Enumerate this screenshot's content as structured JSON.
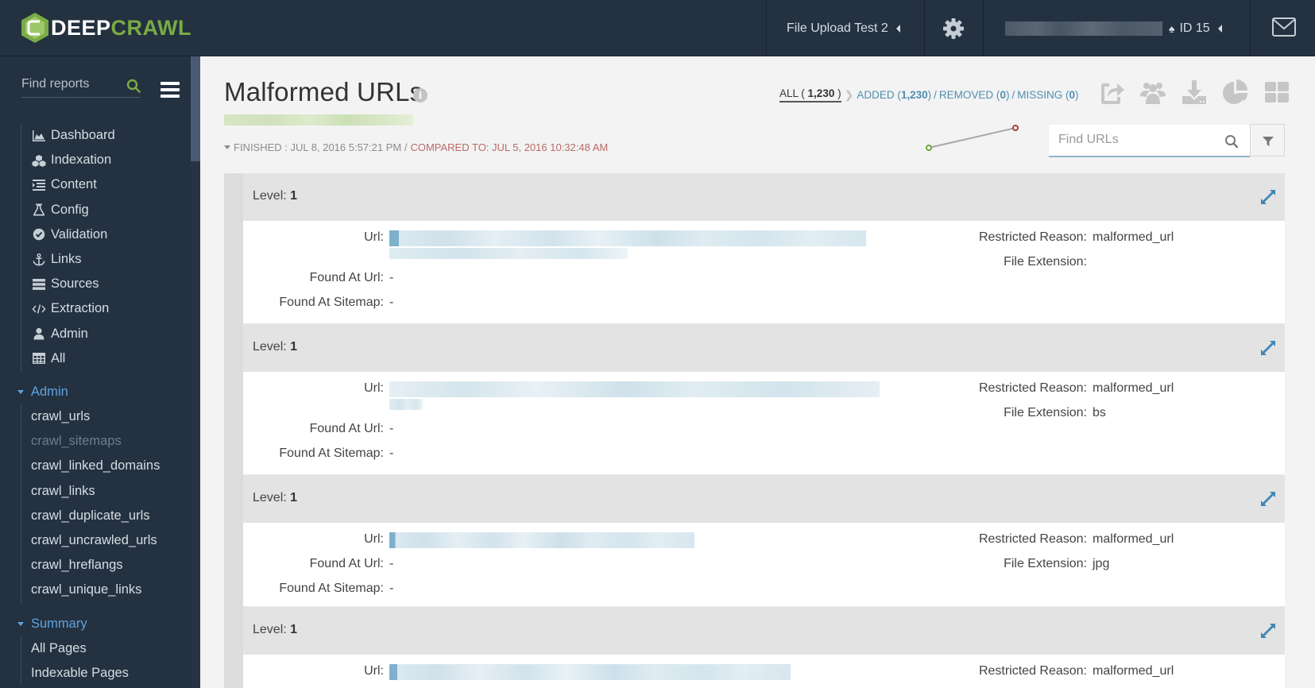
{
  "header": {
    "logo": {
      "part1": "DEEP",
      "part2": "CRAWL"
    },
    "project": "File Upload Test 2",
    "user_id": "ID 15",
    "icons": [
      "gear-icon",
      "spade-icon",
      "mail-icon"
    ]
  },
  "sidebar": {
    "search_placeholder": "Find reports",
    "nav": [
      {
        "label": "Dashboard",
        "icon": "chart-area-icon"
      },
      {
        "label": "Indexation",
        "icon": "cubes-icon"
      },
      {
        "label": "Content",
        "icon": "indent-list-icon"
      },
      {
        "label": "Config",
        "icon": "flask-icon"
      },
      {
        "label": "Validation",
        "icon": "check-circle-icon"
      },
      {
        "label": "Links",
        "icon": "anchor-icon"
      },
      {
        "label": "Sources",
        "icon": "server-icon"
      },
      {
        "label": "Extraction",
        "icon": "code-icon"
      },
      {
        "label": "Admin",
        "icon": "user-icon"
      },
      {
        "label": "All",
        "icon": "table-icon"
      }
    ],
    "sections": [
      {
        "title": "Admin",
        "items": [
          {
            "label": "crawl_urls",
            "disabled": false
          },
          {
            "label": "crawl_sitemaps",
            "disabled": true
          },
          {
            "label": "crawl_linked_domains",
            "disabled": false
          },
          {
            "label": "crawl_links",
            "disabled": false
          },
          {
            "label": "crawl_duplicate_urls",
            "disabled": false
          },
          {
            "label": "crawl_uncrawled_urls",
            "disabled": false
          },
          {
            "label": "crawl_hreflangs",
            "disabled": false
          },
          {
            "label": "crawl_unique_links",
            "disabled": false
          }
        ]
      },
      {
        "title": "Summary",
        "items": [
          {
            "label": "All Pages",
            "disabled": false
          },
          {
            "label": "Indexable Pages",
            "disabled": false
          }
        ]
      }
    ]
  },
  "report": {
    "title": "Malformed URLs",
    "finished": "FINISHED : JUL 8, 2016 5:57:21 PM /",
    "compared": "COMPARED TO: JUL 5, 2016 10:32:48 AM",
    "filters": {
      "all_label": "ALL (",
      "all_count": "1,230",
      "all_close": ")",
      "added_label": "ADDED (",
      "added_count": "1,230",
      "removed_label": "REMOVED (",
      "removed_count": "0",
      "missing_label": "MISSING (",
      "missing_count": "0",
      "close": ")",
      "slash": "/"
    },
    "actions": [
      "share-icon",
      "users-icon",
      "download-icon",
      "pie-chart-icon",
      "grid-icon"
    ],
    "sparkline": {
      "start_color": "#6aa43a",
      "end_color": "#a33a3a"
    },
    "find_urls_placeholder": "Find URLs"
  },
  "labels": {
    "level": "Level:",
    "url": "Url:",
    "found_at_url": "Found At Url:",
    "found_at_sitemap": "Found At Sitemap:",
    "restricted_reason": "Restricted Reason:",
    "file_extension": "File Extension:"
  },
  "records": [
    {
      "level": "1",
      "found_at_url": "-",
      "found_at_sitemap": "-",
      "restricted_reason": "malformed_url",
      "file_extension": ""
    },
    {
      "level": "1",
      "found_at_url": "-",
      "found_at_sitemap": "-",
      "restricted_reason": "malformed_url",
      "file_extension": "bs"
    },
    {
      "level": "1",
      "found_at_url": "-",
      "found_at_sitemap": "-",
      "restricted_reason": "malformed_url",
      "file_extension": "jpg"
    },
    {
      "level": "1",
      "restricted_reason": "malformed_url"
    }
  ],
  "colors": {
    "header_bg": "#243140",
    "brand_green": "#7aab44",
    "link_blue": "#4e8fae",
    "section_blue": "#5fa4e0",
    "compared_red": "#b86a63"
  }
}
